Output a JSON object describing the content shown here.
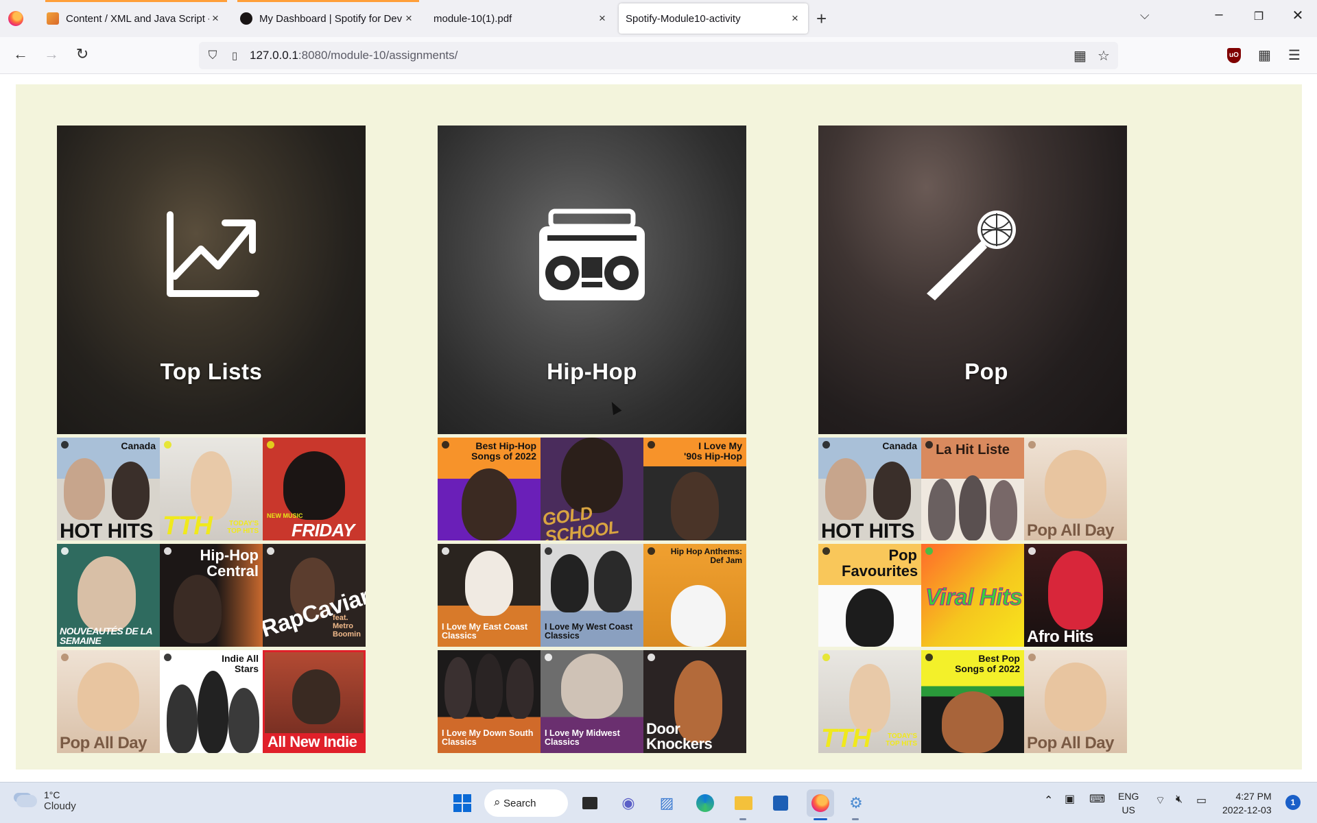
{
  "browser": {
    "tabs": [
      {
        "title": "Content / XML and Java Script -",
        "active": false
      },
      {
        "title": "My Dashboard | Spotify for Dev",
        "active": false
      },
      {
        "title": "module-10(1).pdf",
        "active": false
      },
      {
        "title": "Spotify-Module10-activity",
        "active": true
      }
    ],
    "url_host": "127.0.0.1",
    "url_path": ":8080/module-10/assignments/"
  },
  "categories": [
    {
      "label": "Top Lists",
      "icon": "chart-icon",
      "playlists": [
        {
          "top": "Canada",
          "big": "HOT HITS"
        },
        {
          "big": "TTH",
          "small": "TODAY'S TOP HITS"
        },
        {
          "small": "NEW MUSIC",
          "big": "FRIDAY"
        },
        {
          "big": "NOUVEAUTÉS DE LA SEMAINE"
        },
        {
          "top": "Hip-Hop Central"
        },
        {
          "big": "RapCaviar",
          "small": "feat. Metro Boomin"
        },
        {
          "big": "Pop All Day"
        },
        {
          "top": "Indie All Stars"
        },
        {
          "big": "All New Indie"
        }
      ]
    },
    {
      "label": "Hip-Hop",
      "icon": "boombox-icon",
      "playlists": [
        {
          "top": "Best Hip-Hop Songs of 2022"
        },
        {
          "big": "GOLD SCHOOL"
        },
        {
          "top": "I Love My '90s Hip-Hop"
        },
        {
          "small": "I Love My East Coast Classics"
        },
        {
          "small": "I Love My West Coast Classics"
        },
        {
          "top": "Hip Hop Anthems: Def Jam"
        },
        {
          "small": "I Love My Down South Classics"
        },
        {
          "small": "I Love My Midwest Classics"
        },
        {
          "big": "Door Knockers"
        }
      ]
    },
    {
      "label": "Pop",
      "icon": "microphone-icon",
      "playlists": [
        {
          "top": "Canada",
          "big": "HOT HITS"
        },
        {
          "center": "La Hit Liste"
        },
        {
          "big": "Pop All Day"
        },
        {
          "top": "Pop Favourites"
        },
        {
          "big": "Viral Hits"
        },
        {
          "big": "Afro Hits"
        },
        {
          "big": "TTH",
          "small": "TODAY'S TOP HITS"
        },
        {
          "top": "Best Pop Songs of 2022"
        },
        {
          "big": "Pop All Day"
        }
      ]
    }
  ],
  "taskbar": {
    "weather_temp": "1°C",
    "weather_desc": "Cloudy",
    "search_label": "Search",
    "lang_1": "ENG",
    "lang_2": "US",
    "time": "4:27 PM",
    "date": "2022-12-03",
    "notifications": "1"
  }
}
